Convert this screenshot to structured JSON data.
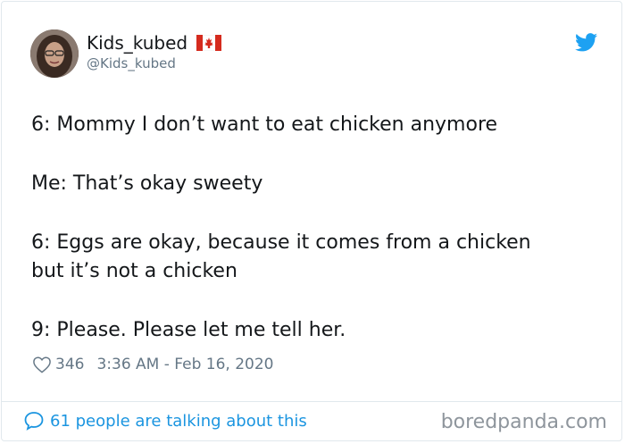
{
  "user": {
    "display_name": "Kids_kubed",
    "handle": "@Kids_kubed"
  },
  "tweet": {
    "lines": [
      "6: Mommy I don’t want to eat chicken anymore",
      "Me: That’s okay sweety",
      "6: Eggs are okay, because it comes from a chicken",
      "but it’s not a chicken",
      "9: Please. Please let me tell her."
    ]
  },
  "meta": {
    "likes": "346",
    "timestamp": "3:36 AM - Feb 16, 2020"
  },
  "footer": {
    "talking_label": "61 people are talking about this",
    "watermark": "boredpanda.com"
  },
  "colors": {
    "twitter_blue": "#1da1f2",
    "link_blue": "#1b95e0",
    "muted": "#657786",
    "flag_red": "#d52b1e"
  },
  "icons": {
    "bird": "twitter-bird-icon",
    "heart": "heart-icon",
    "bubble": "speech-bubble-icon",
    "flag": "canada-flag-icon"
  }
}
